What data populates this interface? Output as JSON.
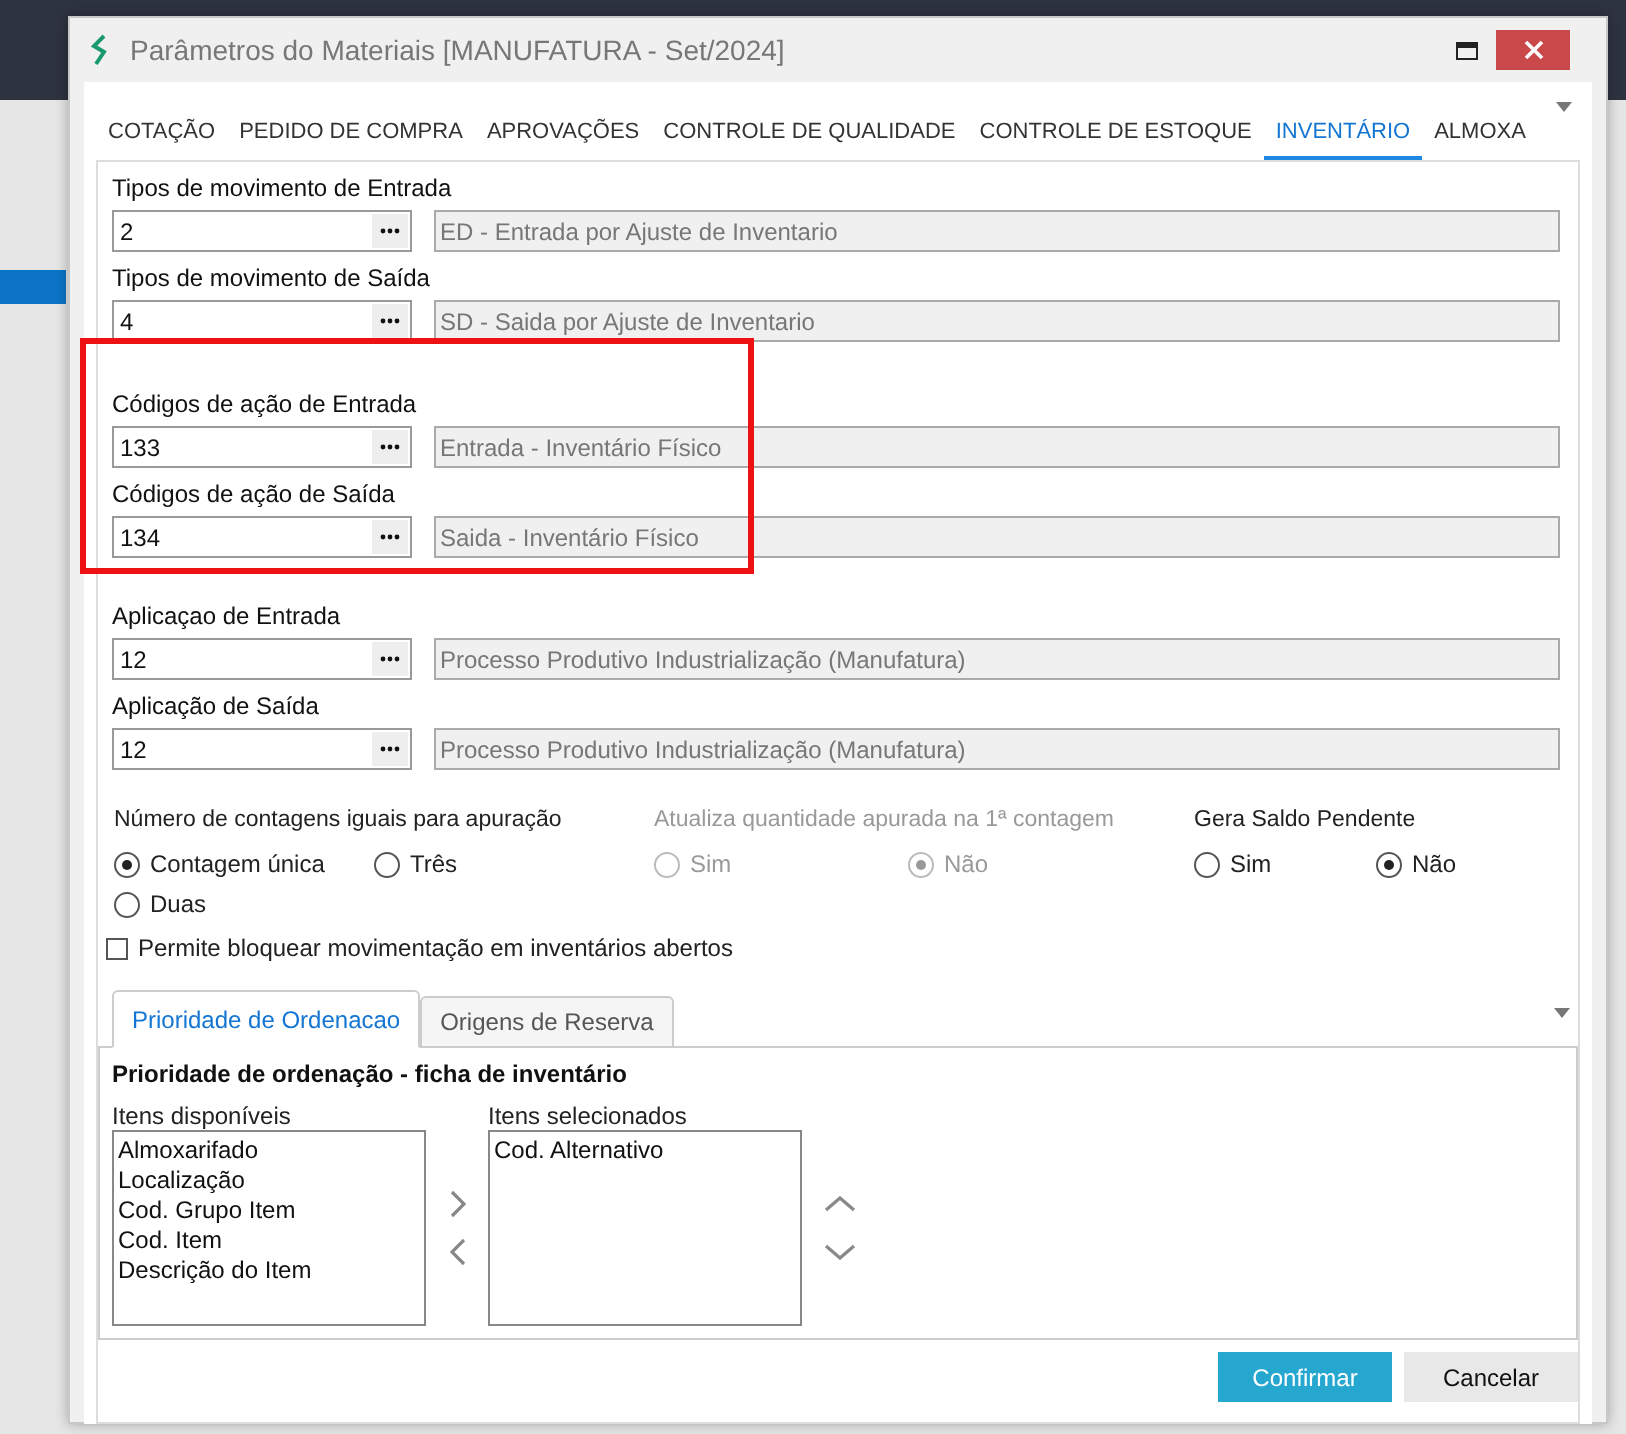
{
  "window": {
    "title": "Parâmetros do Materiais [MANUFATURA - Set/2024]"
  },
  "tabs": [
    {
      "label": "COTAÇÃO",
      "selected": false
    },
    {
      "label": "PEDIDO DE COMPRA",
      "selected": false
    },
    {
      "label": "APROVAÇÕES",
      "selected": false
    },
    {
      "label": "CONTROLE DE QUALIDADE",
      "selected": false
    },
    {
      "label": "CONTROLE DE ESTOQUE",
      "selected": false
    },
    {
      "label": "INVENTÁRIO",
      "selected": true
    },
    {
      "label": "ALMOXA",
      "selected": false
    }
  ],
  "fields": [
    {
      "label": "Tipos de movimento de Entrada",
      "code": "2",
      "description": "ED - Entrada por Ajuste de Inventario"
    },
    {
      "label": "Tipos de movimento de Saída",
      "code": "4",
      "description": "SD - Saida por Ajuste de Inventario"
    },
    {
      "label": "Códigos de ação de Entrada",
      "code": "133",
      "description": "Entrada - Inventário Físico"
    },
    {
      "label": "Códigos de ação de Saída",
      "code": "134",
      "description": "Saida - Inventário Físico"
    },
    {
      "label": "Aplicaçao de Entrada",
      "code": "12",
      "description": "Processo Produtivo Industrialização (Manufatura)"
    },
    {
      "label": "Aplicação de Saída",
      "code": "12",
      "description": "Processo Produtivo Industrialização (Manufatura)"
    }
  ],
  "radio_groups": [
    {
      "title": "Número de contagens iguais para apuração",
      "disabled": false,
      "options": [
        {
          "label": "Contagem única",
          "selected": true
        },
        {
          "label": "Três",
          "selected": false
        },
        {
          "label": "Duas",
          "selected": false
        }
      ]
    },
    {
      "title": "Atualiza quantidade apurada na 1ª contagem",
      "disabled": true,
      "options": [
        {
          "label": "Sim",
          "selected": false
        },
        {
          "label": "Não",
          "selected": true
        }
      ]
    },
    {
      "title": "Gera Saldo Pendente",
      "disabled": false,
      "options": [
        {
          "label": "Sim",
          "selected": false
        },
        {
          "label": "Não",
          "selected": true
        }
      ]
    }
  ],
  "checkbox": {
    "label": "Permite bloquear movimentação em inventários abertos",
    "checked": false
  },
  "subtabs": [
    {
      "label": "Prioridade de Ordenacao",
      "selected": true
    },
    {
      "label": "Origens de Reserva",
      "selected": false
    }
  ],
  "ordering": {
    "title": "Prioridade de ordenação - ficha de inventário",
    "available": {
      "label": "Itens disponíveis",
      "items": [
        "Almoxarifado",
        "Localização",
        "Cod. Grupo Item",
        "Cod. Item",
        "Descrição do Item"
      ]
    },
    "selected": {
      "label": "Itens selecionados",
      "items": [
        "Cod. Alternativo"
      ]
    }
  },
  "buttons": [
    {
      "label": "Confirmar",
      "kind": "primary"
    },
    {
      "label": "Cancelar",
      "kind": "secondary"
    }
  ]
}
